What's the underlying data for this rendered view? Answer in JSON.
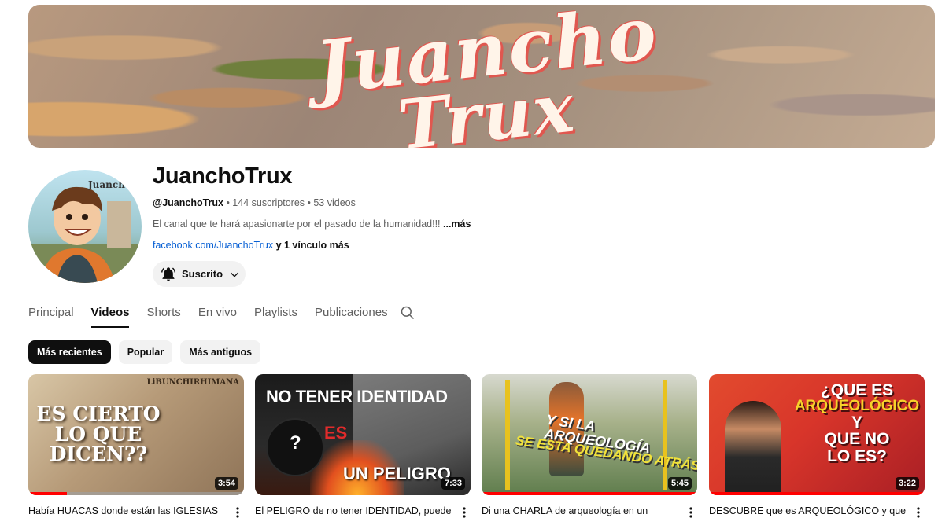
{
  "banner": {
    "line1": "Juancho",
    "line2": "Trux"
  },
  "channel": {
    "avatar_text": "Juancho",
    "name": "JuanchoTrux",
    "handle": "@JuanchoTrux",
    "stats": " • 144 suscriptores • 53 videos",
    "description": "El canal que te hará apasionarte por el pasado de la humanidad!!! ",
    "more_label": "...más",
    "link": "facebook.com/JuanchoTrux",
    "extra_links": " y 1 vínculo más",
    "subscribe_label": "Suscrito"
  },
  "tabs": [
    {
      "label": "Principal",
      "active": false
    },
    {
      "label": "Videos",
      "active": true
    },
    {
      "label": "Shorts",
      "active": false
    },
    {
      "label": "En vivo",
      "active": false
    },
    {
      "label": "Playlists",
      "active": false
    },
    {
      "label": "Publicaciones",
      "active": false
    }
  ],
  "chips": [
    {
      "label": "Más recientes",
      "active": true
    },
    {
      "label": "Popular",
      "active": false
    },
    {
      "label": "Más antiguos",
      "active": false
    }
  ],
  "videos": [
    {
      "title": "Había HUACAS donde están las IGLESIAS",
      "duration": "3:54",
      "progress": 0.18,
      "thumb_text": [
        "ES CIERTO",
        "LO QUE",
        "DICEN??"
      ],
      "thumb_watermark": "LiBUNCHIRHIMANA"
    },
    {
      "title": "El PELIGRO de no tener IDENTIDAD, puede la",
      "duration": "7:33",
      "progress": 0.0,
      "thumb_text": [
        "NO TENER IDENTIDAD",
        "ES",
        "UN PELIGRO"
      ],
      "thumb_mark": "?"
    },
    {
      "title": "Di una CHARLA de arqueología en un",
      "duration": "5:45",
      "progress": 1.0,
      "thumb_text": [
        "Y SI LA ARQUEOLOGÍA",
        "SE ESTA QUEDANDO ATRÁS"
      ]
    },
    {
      "title": "DESCUBRE que es ARQUEOLÓGICO y que no",
      "duration": "3:22",
      "progress": 1.0,
      "thumb_text": [
        "¿QUE ES",
        "ARQUEOLÓGICO",
        "Y",
        "QUE NO",
        "LO ES?"
      ]
    }
  ]
}
